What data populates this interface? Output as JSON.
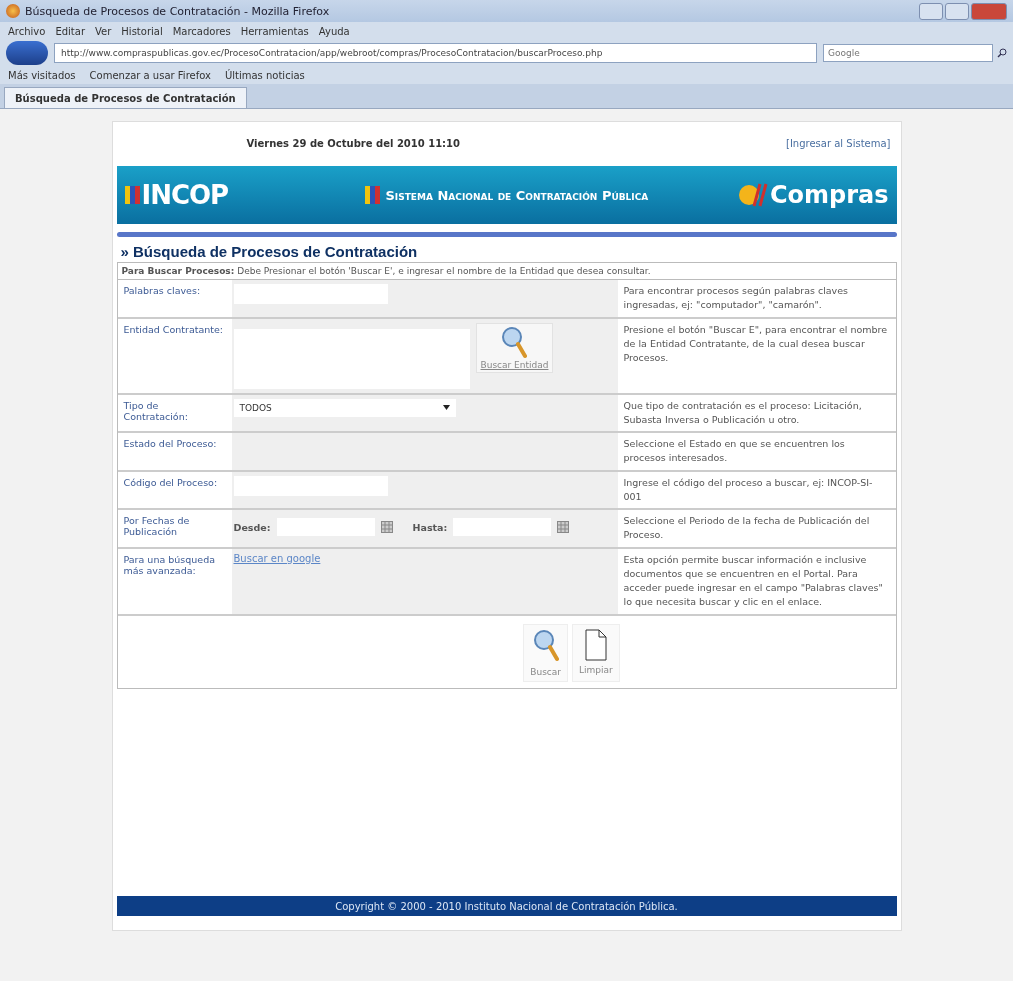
{
  "window": {
    "title": "Búsqueda de Procesos de Contratación - Mozilla Firefox"
  },
  "menu": [
    "Archivo",
    "Editar",
    "Ver",
    "Historial",
    "Marcadores",
    "Herramientas",
    "Ayuda"
  ],
  "address_bar": {
    "value": "http://www.compraspublicas.gov.ec/ProcesoContratacion/app/webroot/compras/ProcesoContratacion/buscarProceso.php"
  },
  "search_box": {
    "placeholder": "Google"
  },
  "bookmarks": [
    "Más visitados",
    "Comenzar a usar Firefox",
    "Últimas noticias"
  ],
  "tabs": [
    {
      "label": "Búsqueda de Procesos de Contratación",
      "selected": true
    }
  ],
  "page": {
    "date": "Viernes 29 de Octubre del 2010 11:10",
    "login_link": "[Ingresar al Sistema]",
    "banner": {
      "logo": "INCOP",
      "title": "Sistema Nacional de Contratación Pública",
      "brand": "Compras"
    },
    "heading": "» Búsqueda de Procesos de Contratación",
    "instructions": "**Para Buscar Procesos:** Debe Presionar el botón 'Buscar E', e ingresar el nombre de la Entidad que desea consultar.",
    "rows": [
      {
        "kind": "text",
        "label": "Palabras claves:",
        "help": "Para encontrar procesos según palabras claves ingresadas, ej: \"computador\", \"camarón\"."
      },
      {
        "kind": "entity",
        "label": "Entidad Contratante:",
        "button": "Buscar Entidad",
        "help": "Presione el botón \"Buscar E\", para encontrar el nombre de la Entidad Contratante, de la cual desea buscar Procesos."
      },
      {
        "kind": "select",
        "label": "Tipo de Contratación:",
        "value": "TODOS",
        "help": "Que tipo de contratación es el proceso: Licitación, Subasta Inversa o Publicación u otro."
      },
      {
        "kind": "empty",
        "label": "Estado del Proceso:",
        "help": "Seleccione el Estado en que se encuentren los procesos interesados."
      },
      {
        "kind": "text",
        "label": "Código del Proceso:",
        "help": "Ingrese el código del proceso a buscar, ej: INCOP-SI-001"
      },
      {
        "kind": "dates",
        "label": "Por Fechas de Publicación",
        "from_label": "Desde:",
        "to_label": "Hasta:",
        "help": "Seleccione el Periodo de la fecha de Publicación del Proceso."
      },
      {
        "kind": "link",
        "label": "Para una búsqueda más avanzada:",
        "link": "Buscar en google",
        "help": "Esta opción permite buscar información e inclusive documentos que se encuentren en el Portal. Para acceder puede ingresar en el campo \"Palabras claves\" lo que necesita buscar y clic en el enlace."
      }
    ],
    "actions": [
      {
        "kind": "search",
        "label": "Buscar"
      },
      {
        "kind": "clear",
        "label": "Limpiar"
      }
    ],
    "footer": "Copyright © 2000 - 2010 Instituto Nacional de Contratación Pública."
  }
}
